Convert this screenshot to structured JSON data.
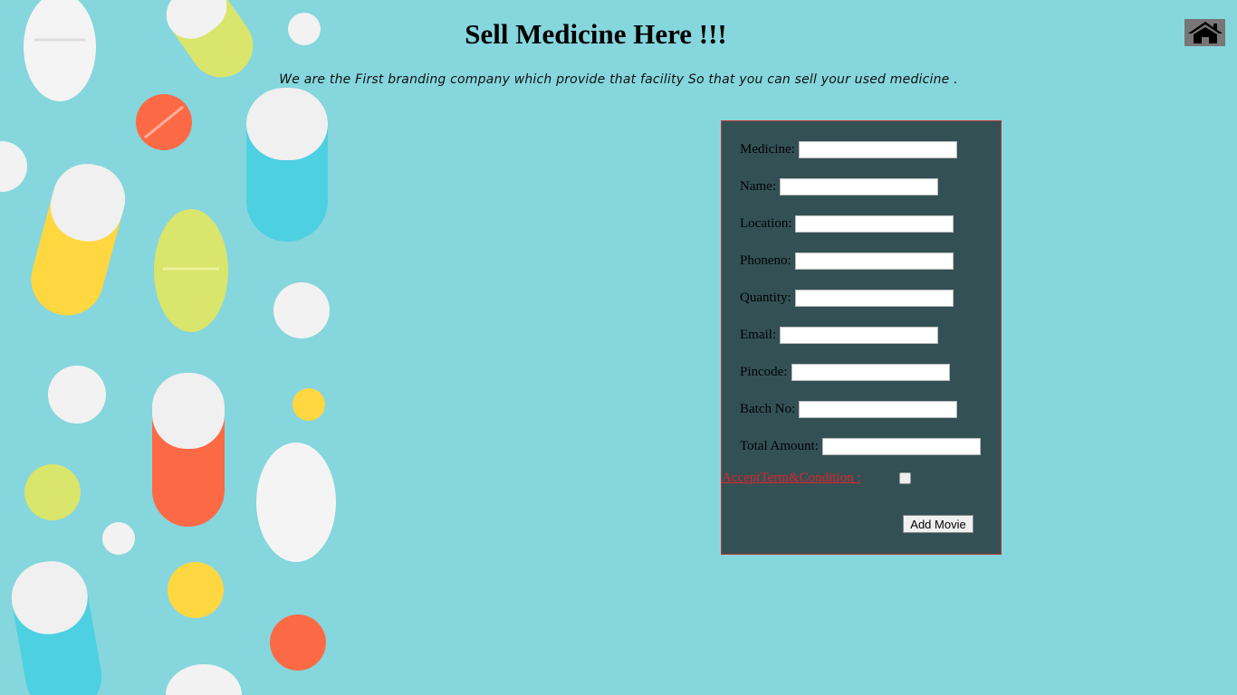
{
  "page": {
    "title": "Sell Medicine Here !!!",
    "subtitle": "We are the First branding company which provide that facility So that you can sell your used medicine ."
  },
  "header": {
    "home_icon": "home-icon"
  },
  "form": {
    "fields": [
      {
        "label": "Medicine:",
        "value": ""
      },
      {
        "label": "Name:",
        "value": ""
      },
      {
        "label": "Location:",
        "value": ""
      },
      {
        "label": "Phoneno:",
        "value": ""
      },
      {
        "label": "Quantity:",
        "value": ""
      },
      {
        "label": "Email:",
        "value": ""
      },
      {
        "label": "Pincode:",
        "value": ""
      },
      {
        "label": "Batch No:",
        "value": ""
      },
      {
        "label": "Total Amount:",
        "value": ""
      }
    ],
    "terms_label": "AcceptTerm&Condition :",
    "terms_checked": false,
    "submit_label": "Add Movie"
  },
  "colors": {
    "background": "#86d6dd",
    "form_background": "#335155",
    "form_border": "#c0393b",
    "terms_text": "#e0222a"
  }
}
